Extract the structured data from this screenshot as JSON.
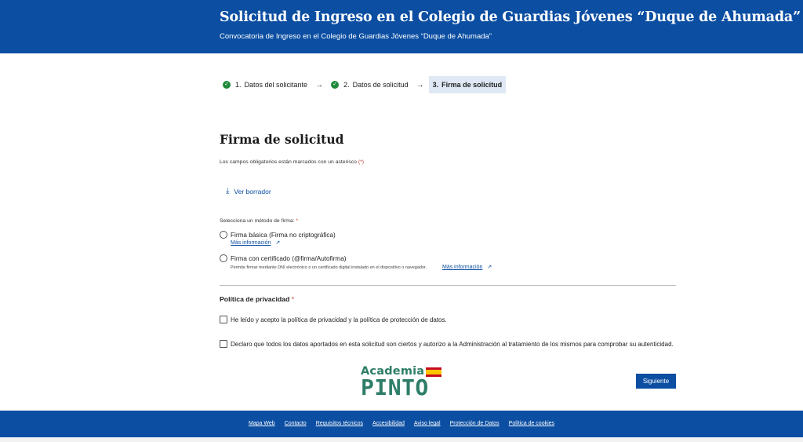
{
  "header": {
    "title": "Solicitud de Ingreso en el Colegio de Guardias Jóvenes “Duque de Ahumada”",
    "subtitle": "Convocatoria de Ingreso en el Colegio de Guardias Jóvenes “Duque de Ahumada”"
  },
  "steps": [
    {
      "num": "1.",
      "label": "Datos del solicitante",
      "status": "done"
    },
    {
      "num": "2.",
      "label": "Datos de solicitud",
      "status": "done"
    },
    {
      "num": "3.",
      "label": "Firma de solicitud",
      "status": "active"
    }
  ],
  "form": {
    "title": "Firma de solicitud",
    "required_note": "Los campos obligatorios están marcados con un asterisco",
    "required_mark": "(*)",
    "draft_link": "Ver borrador",
    "sign_method_label": "Selecciona un método de firma:",
    "sign_options": [
      {
        "label": "Firma básica (Firma no criptográfica)",
        "info": "Más información"
      },
      {
        "label": "Firma con certificado (@firma/Autofirma)",
        "help": "Permite firmar mediante DNI electrónico o un certificado digital instalado en el dispositivo o navegador.",
        "info": "Más información"
      }
    ],
    "privacy_title": "Política de privacidad",
    "checks": [
      "He leído y acepto la política de privacidad y la política de protección de datos.",
      "Declaro que todos los datos aportados en esta solicitud son ciertos y autorizo a la Administración al tratamiento de los mismos para comprobar su autenticidad."
    ],
    "next_button": "Siguiente"
  },
  "logo": {
    "line1": "Academia",
    "line2": "PINTO"
  },
  "footer": {
    "links": [
      "Mapa Web",
      "Contacto",
      "Requisitos técnicos",
      "Accesibilidad",
      "Aviso legal",
      "Protección de Datos",
      "Política de cookies"
    ]
  },
  "colors": {
    "primary": "#0b4ea2",
    "success": "#1f8a3a",
    "required": "#c0392b",
    "logo_green": "#2e7d68"
  }
}
